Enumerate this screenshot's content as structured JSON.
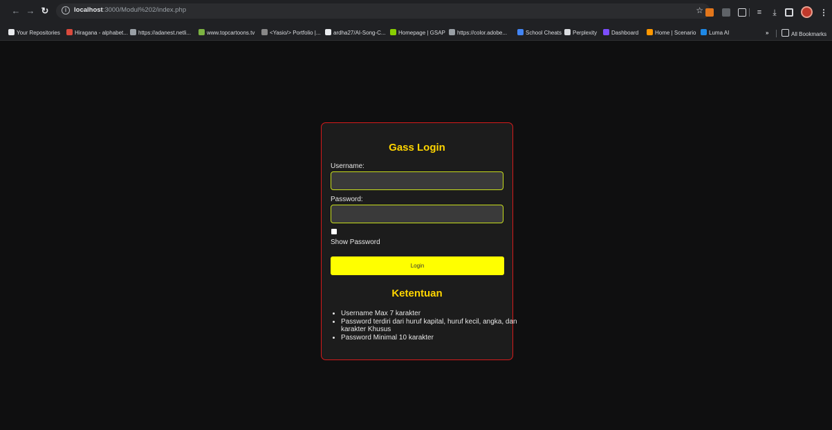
{
  "browser": {
    "url_host": "localhost",
    "url_rest": ":3000/Modul%202/index.php",
    "bookmarks": [
      {
        "label": "Your Repositories",
        "icon": "github-icon",
        "color": "#e8eaed"
      },
      {
        "label": "Hiragana - alphabet...",
        "icon": "hiragana-icon",
        "color": "#d94a3d"
      },
      {
        "label": "https://adanest.netli...",
        "icon": "netlify-icon",
        "color": "#9aa0a6"
      },
      {
        "label": "www.topcartoons.tv",
        "icon": "topcartoons-icon",
        "color": "#7cb342"
      },
      {
        "label": "<Yasio/> Portfolio |...",
        "icon": "portfolio-icon",
        "color": "#888888"
      },
      {
        "label": "ardha27/AI-Song-C...",
        "icon": "github-icon",
        "color": "#e8eaed"
      },
      {
        "label": "Homepage | GSAP",
        "icon": "gsap-icon",
        "color": "#88ce02"
      },
      {
        "label": "https://color.adobe...",
        "icon": "adobe-color-icon",
        "color": "#9aa0a6"
      },
      {
        "label": "School Cheats",
        "icon": "school-cheats-icon",
        "color": "#4285f4"
      },
      {
        "label": "Perplexity",
        "icon": "perplexity-icon",
        "color": "#dadce0"
      },
      {
        "label": "Dashboard",
        "icon": "dashboard-icon",
        "color": "#7c4dff"
      },
      {
        "label": "Home | Scenario",
        "icon": "scenario-icon",
        "color": "#ff9800"
      },
      {
        "label": "Luma AI",
        "icon": "luma-icon",
        "color": "#1e88e5"
      }
    ],
    "more_label": "»",
    "all_bookmarks": "All Bookmarks"
  },
  "login": {
    "title": "Gass Login",
    "username_label": "Username:",
    "username_value": "",
    "password_label": "Password:",
    "password_value": "",
    "show_password_label": "Show Password",
    "show_password_checked": false,
    "login_button": "Login"
  },
  "rules": {
    "title": "Ketentuan",
    "items": [
      "Username Max 7 karakter",
      "Password terdiri dari huruf kapital, huruf kecil, angka, dan karakter Khusus",
      "Password Minimal 10 karakter"
    ]
  },
  "colors": {
    "accent_yellow": "#ffd500",
    "button_yellow": "#ffff00",
    "card_border": "#d81b1b",
    "input_border": "#c9df1c"
  }
}
